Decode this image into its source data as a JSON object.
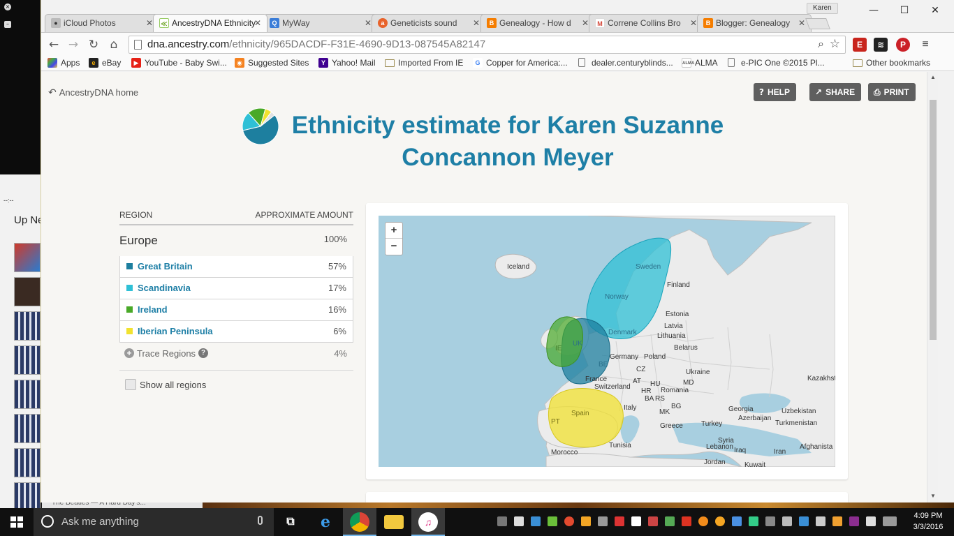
{
  "tabs": [
    {
      "label": "iCloud Photos",
      "icon": "apple-icon",
      "active": false
    },
    {
      "label": "AncestryDNA Ethnicity",
      "icon": "ancestry-leaf-icon",
      "active": true
    },
    {
      "label": "MyWay",
      "icon": "myway-search-icon",
      "active": false
    },
    {
      "label": "Geneticists sound",
      "icon": "ars-icon",
      "active": false
    },
    {
      "label": "Genealogy - How d",
      "icon": "blogger-icon",
      "active": false
    },
    {
      "label": "Correne Collins Bro",
      "icon": "gmail-icon",
      "active": false
    },
    {
      "label": "Blogger: Genealogy",
      "icon": "blogger-icon",
      "active": false
    }
  ],
  "profile_name": "Karen",
  "omnibox": {
    "host": "dna.ancestry.com",
    "path": "/ethnicity/965DACDF-F31E-4690-9D13-087545A82147"
  },
  "bookmarks": [
    "Apps",
    "eBay",
    "YouTube - Baby Swi...",
    "Suggested Sites",
    "Yahoo! Mail",
    "Imported From IE",
    "Copper for America:...",
    "dealer.centuryblinds...",
    "ALMA",
    "e-PIC One ©2015 Pl...",
    "Other bookmarks"
  ],
  "page": {
    "home_link": "AncestryDNA home",
    "buttons": {
      "help": "HELP",
      "share": "SHARE",
      "print": "PRINT"
    },
    "title": "Ethnicity estimate for Karen Suzanne Concannon Meyer",
    "table_headers": {
      "region": "REGION",
      "amount": "APPROXIMATE AMOUNT"
    },
    "group": {
      "name": "Europe",
      "amount": "100%"
    },
    "regions": [
      {
        "name": "Great Britain",
        "amount": "57%",
        "color": "#1d7f9f",
        "value": 57
      },
      {
        "name": "Scandinavia",
        "amount": "17%",
        "color": "#2fc0d6",
        "value": 17
      },
      {
        "name": "Ireland",
        "amount": "16%",
        "color": "#49a928",
        "value": 16
      },
      {
        "name": "Iberian Peninsula",
        "amount": "6%",
        "color": "#f1e230",
        "value": 6
      }
    ],
    "trace": {
      "name": "Trace Regions",
      "amount": "4%",
      "color": "#e2e2e2",
      "value": 4
    },
    "show_all": "Show all regions"
  },
  "map": {
    "zoom_in": "+",
    "zoom_out": "−",
    "labels": [
      "Iceland",
      "Sweden",
      "Finland",
      "Norway",
      "Estonia",
      "Latvia",
      "Lithuania",
      "Denmark",
      "Belarus",
      "IE",
      "UK",
      "Germany",
      "Poland",
      "BE",
      "CZ",
      "Ukraine",
      "France",
      "Switzerland",
      "AT",
      "HU",
      "MD",
      "HR",
      "Romania",
      "BA",
      "RS",
      "Kazakhst",
      "Italy",
      "BG",
      "Georgia",
      "Uzbekistan",
      "Spain",
      "MK",
      "Azerbaijan",
      "PT",
      "Greece",
      "Turkey",
      "Turkmenistan",
      "Tunisia",
      "Syria",
      "Afghanista",
      "Lebanon",
      "Iraq",
      "Iran",
      "Morocco",
      "Jordan",
      "Kuwait"
    ]
  },
  "background": {
    "time_label": "--:--",
    "up_next": "Up Next",
    "now_playing": "The Beatles — A Hard Day's..."
  },
  "taskbar": {
    "search_placeholder": "Ask me anything",
    "time": "4:09 PM",
    "date": "3/3/2016"
  }
}
